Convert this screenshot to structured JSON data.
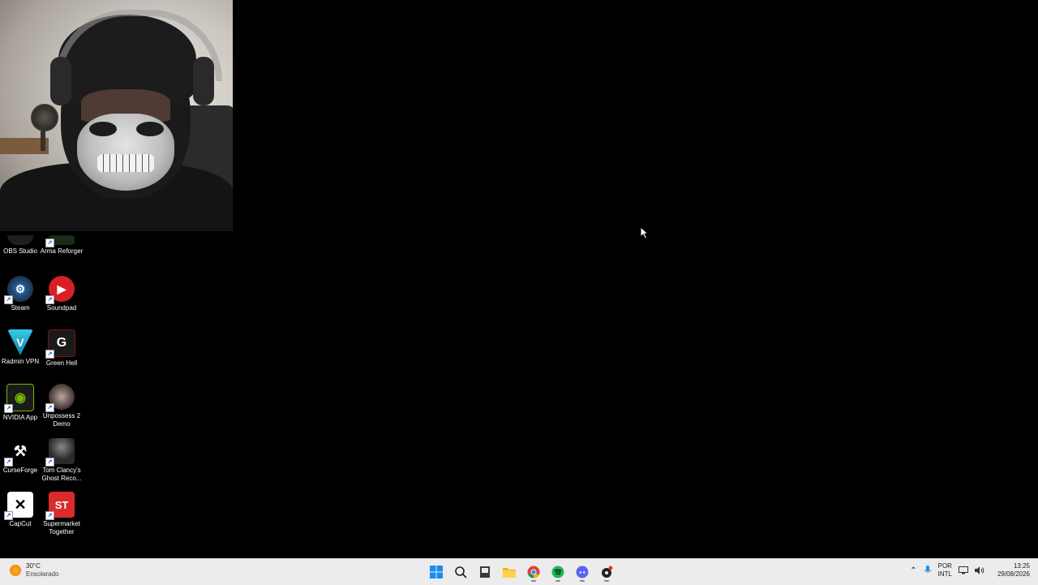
{
  "desktop": {
    "icons": [
      {
        "label": "OBS Studio",
        "icon": "obs-icon",
        "color": "#1e1e1e"
      },
      {
        "label": "Arma Reforger",
        "icon": "arma-icon",
        "color": "#1c2a1a"
      },
      {
        "label": "Steam",
        "icon": "steam-icon",
        "color": "#1b2838"
      },
      {
        "label": "Soundpad",
        "icon": "soundpad-icon",
        "color": "#d81f26"
      },
      {
        "label": "Radmin VPN",
        "icon": "radmin-icon",
        "color": "#1aa3c8"
      },
      {
        "label": "Green Hell",
        "icon": "greenhell-icon",
        "color": "#8a0f0f"
      },
      {
        "label": "NVIDIA App",
        "icon": "nvidia-icon",
        "color": "#76b900"
      },
      {
        "label": "Unpossess 2 Demo",
        "icon": "unpossess-icon",
        "color": "#3a2a2a"
      },
      {
        "label": "CurseForge",
        "icon": "curseforge-icon",
        "color": "#000000"
      },
      {
        "label": "Tom Clancy's Ghost Reco...",
        "icon": "ghostrecon-icon",
        "color": "#2a2a2a"
      },
      {
        "label": "CapCut",
        "icon": "capcut-icon",
        "color": "#ffffff"
      },
      {
        "label": "Supermarket Together",
        "icon": "supermarket-icon",
        "color": "#d92b2b"
      }
    ]
  },
  "taskbar": {
    "weather": {
      "temp": "30°C",
      "condition": "Ensolarado"
    },
    "apps": [
      "start-icon",
      "search-icon",
      "file-icon",
      "folder-icon",
      "chrome-icon",
      "spotify-icon",
      "discord-icon",
      "app-icon"
    ],
    "tray": {
      "lang_top": "POR",
      "lang_bottom": "INTL",
      "time": "13:25",
      "date": "29/08/2026"
    }
  }
}
